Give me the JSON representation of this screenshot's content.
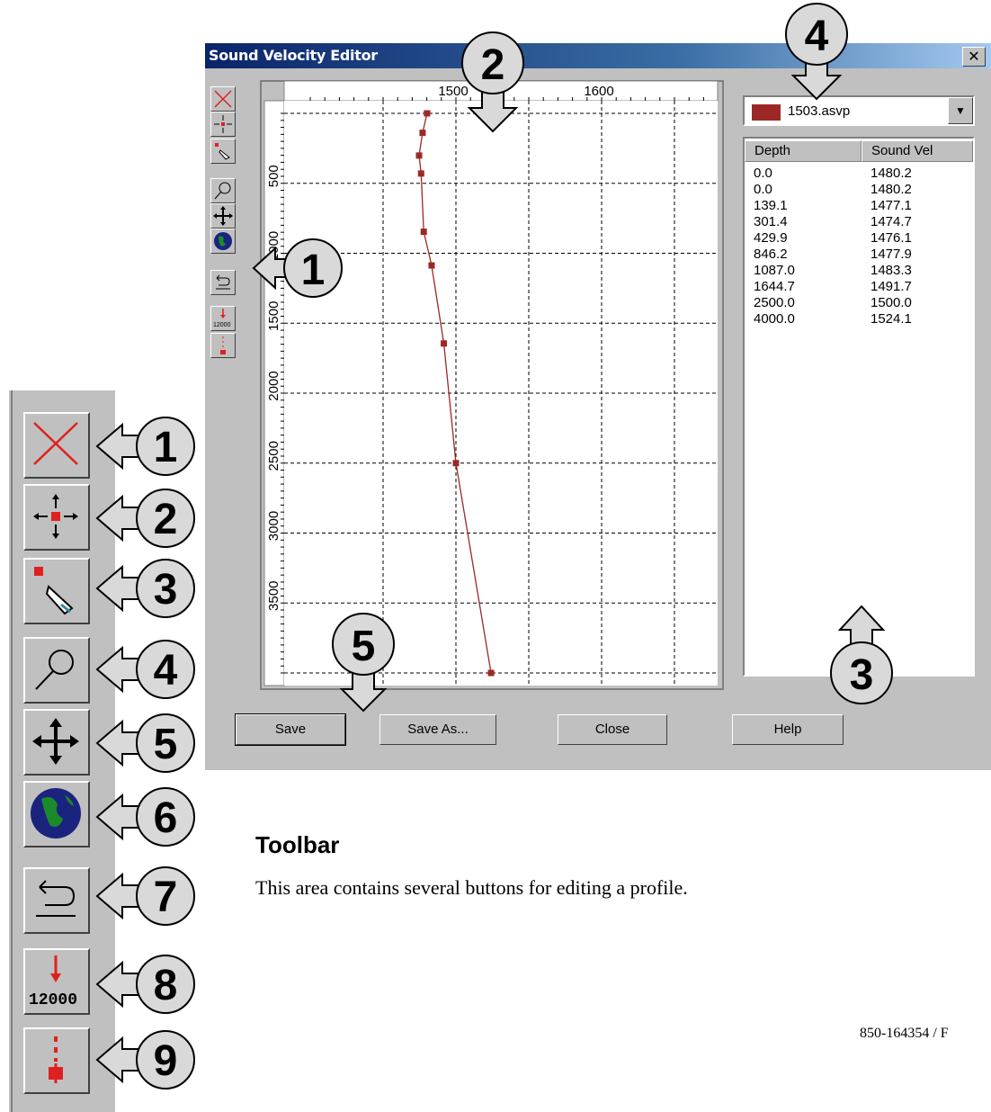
{
  "window": {
    "title": "Sound Velocity Editor",
    "close_label": "✕"
  },
  "plot": {
    "x_ticks": [
      "1500",
      "1600"
    ],
    "y_ticks": [
      "500",
      "1000",
      "1500",
      "2000",
      "2500",
      "3000",
      "3500"
    ]
  },
  "chart_data": {
    "type": "line",
    "xlim": [
      1400,
      1600
    ],
    "ylim": [
      0,
      4000
    ],
    "x": [
      1480.2,
      1480.2,
      1477.1,
      1474.7,
      1476.1,
      1477.9,
      1483.3,
      1491.7,
      1500.0,
      1524.1
    ],
    "y": [
      0.0,
      0.0,
      139.1,
      301.4,
      429.9,
      846.2,
      1087.0,
      1644.7,
      2500.0,
      4000.0
    ],
    "x_tick_labels": [
      "1500",
      "1600"
    ],
    "y_tick_labels": [
      "500",
      "1000",
      "1500",
      "2000",
      "2500",
      "3000",
      "3500"
    ],
    "line_color": "#9c2826",
    "grid": true
  },
  "profile": {
    "file": "1503.asvp",
    "color": "#9c2826",
    "columns": [
      "Depth",
      "Sound Vel"
    ],
    "rows": [
      [
        "0.0",
        "1480.2"
      ],
      [
        "0.0",
        "1480.2"
      ],
      [
        "139.1",
        "1477.1"
      ],
      [
        "301.4",
        "1474.7"
      ],
      [
        "429.9",
        "1476.1"
      ],
      [
        "846.2",
        "1477.9"
      ],
      [
        "1087.0",
        "1483.3"
      ],
      [
        "1644.7",
        "1491.7"
      ],
      [
        "2500.0",
        "1500.0"
      ],
      [
        "4000.0",
        "1524.1"
      ]
    ]
  },
  "buttons": {
    "save": "Save",
    "save_as": "Save As...",
    "close": "Close",
    "help": "Help"
  },
  "window_callouts": [
    "1",
    "2",
    "3",
    "4",
    "5"
  ],
  "toolbar_callouts": [
    "1",
    "2",
    "3",
    "4",
    "5",
    "6",
    "7",
    "8",
    "9"
  ],
  "toolbar_icons": [
    "delete-point-icon",
    "move-point-icon",
    "add-point-icon",
    "zoom-icon",
    "pan-icon",
    "globe-icon",
    "undo-icon",
    "extend-depth-icon",
    "insert-point-icon"
  ],
  "extend_label": "12000",
  "section": {
    "heading": "Toolbar",
    "text": "This area contains several buttons for editing a profile."
  },
  "footer": "850-164354 / F"
}
